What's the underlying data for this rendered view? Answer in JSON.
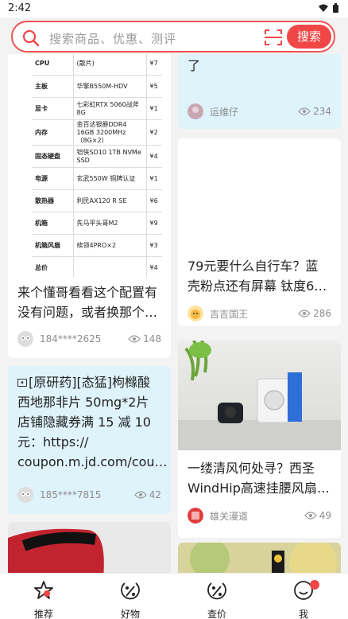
{
  "status": {
    "time": "2:42"
  },
  "search": {
    "placeholder": "搜索商品、优惠、测评",
    "button": "搜索"
  },
  "cards": {
    "c1": {
      "spec_rows": [
        {
          "k": "CPU",
          "v": "(散片)",
          "p": "¥7"
        },
        {
          "k": "主板",
          "v": "华擎B550M-HDV",
          "p": "¥5"
        },
        {
          "k": "显卡",
          "v": "七彩虹RTX 5060战斧 8G",
          "p": "¥1"
        },
        {
          "k": "内存",
          "v": "金百达银爵DDR4 16GB 3200MHz（8G×2）",
          "p": "¥2"
        },
        {
          "k": "固态硬盘",
          "v": "铠侠SD10 1TB NVMe SSD",
          "p": "¥4"
        },
        {
          "k": "电源",
          "v": "玄武550W 铜牌认证",
          "p": "¥1"
        },
        {
          "k": "散热器",
          "v": "利民AX120 R SE",
          "p": "¥6"
        },
        {
          "k": "机箱",
          "v": "先马平头哥M2",
          "p": "¥9"
        },
        {
          "k": "机箱风扇",
          "v": "续领4PRO×2",
          "p": "¥3"
        },
        {
          "k": "总价",
          "v": "",
          "p": "¥4"
        }
      ],
      "title_l1": "来个懂哥看看这个配置有",
      "title_l2": "没有问题，或者换那个…",
      "user": "184****2625",
      "views": "148"
    },
    "c2": {
      "title": "了",
      "user": "运维仔",
      "views": "234"
    },
    "c3": {
      "title_l1": "79元要什么自行车？蓝",
      "title_l2": "壳粉点还有屏幕 钛度6…",
      "user": "吉吉国王",
      "views": "286"
    },
    "c4": {
      "l1": "[原研药][态猛]枸橼酸",
      "l2": "西地那非片 50mg*2片",
      "l3": "店铺隐藏券满 15 减 10",
      "l4": "元：https://",
      "l5": "coupon.m.jd.com/cou…",
      "user": "185****7815",
      "views": "42"
    },
    "c5": {
      "title_l1": "一缕清风何处寻？西圣",
      "title_l2": "WindHip高速挂腰风扇…",
      "user": "雄关漫道",
      "views": "49"
    }
  },
  "tabs": [
    {
      "label": "推荐"
    },
    {
      "label": "好物"
    },
    {
      "label": "查价"
    },
    {
      "label": "我"
    }
  ],
  "colors": {
    "accent": "#f04646",
    "blue_card": "#dff3fb"
  }
}
